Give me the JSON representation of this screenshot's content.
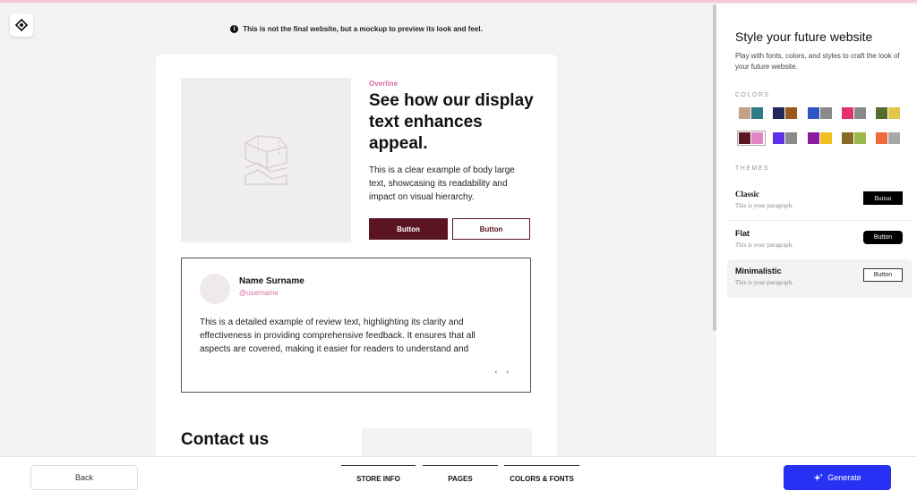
{
  "notice": {
    "icon": "info-icon",
    "text": "This is not the final website, but a mockup to preview its look and feel."
  },
  "logo": {
    "icon": "brand-logo-icon"
  },
  "preview": {
    "hero": {
      "image_icon": "image-placeholder-icon",
      "overline": "Overline",
      "display": "See how our display text enhances appeal.",
      "body": "This is a clear example of body large text, showcasing its readability and impact on visual hierarchy.",
      "primary_button": "Button",
      "secondary_button": "Button"
    },
    "review": {
      "name": "Name Surname",
      "username": "@username",
      "text": "This is a detailed example of review text, highlighting its clarity and effectiveness in providing comprehensive feedback. It ensures that all aspects are covered, making it easier for readers to understand and",
      "prev_arrow": "‹",
      "next_arrow": "›"
    },
    "contact": {
      "title": "Contact us"
    }
  },
  "sidebar": {
    "title": "Style your future website",
    "subtitle": "Play with fonts, colors, and styles to craft the look of your future website.",
    "colors_label": "COLORS",
    "palettes": [
      {
        "colors": [
          "#c4a287",
          "#2e7b86"
        ],
        "selected": false
      },
      {
        "colors": [
          "#232a58",
          "#9a5a1c"
        ],
        "selected": false
      },
      {
        "colors": [
          "#2f56c4",
          "#8a8a8a"
        ],
        "selected": false
      },
      {
        "colors": [
          "#e0336b",
          "#8a8a8a"
        ],
        "selected": false
      },
      {
        "colors": [
          "#556b2f",
          "#e0c64a"
        ],
        "selected": false
      },
      {
        "colors": [
          "#5a1422",
          "#e386c3"
        ],
        "selected": true
      },
      {
        "colors": [
          "#5b32e8",
          "#8a8a8a"
        ],
        "selected": false
      },
      {
        "colors": [
          "#8a1aa0",
          "#f0c020"
        ],
        "selected": false
      },
      {
        "colors": [
          "#8a6a28",
          "#9ab94a"
        ],
        "selected": false
      },
      {
        "colors": [
          "#ee6a3c",
          "#a8a8a8"
        ],
        "selected": false
      }
    ],
    "themes_label": "THEMES",
    "themes": [
      {
        "name": "Classic",
        "paragraph": "This is your paragraph.",
        "button": "Button",
        "selected": false
      },
      {
        "name": "Flat",
        "paragraph": "This is your paragraph.",
        "button": "Button",
        "selected": false
      },
      {
        "name": "Minimalistic",
        "paragraph": "This is your paragraph.",
        "button": "Button",
        "selected": true
      }
    ]
  },
  "footer": {
    "back": "Back",
    "steps": [
      "STORE INFO",
      "PAGES",
      "COLORS & FONTS"
    ],
    "generate": "Generate",
    "generate_icon": "sparkle-icon"
  }
}
